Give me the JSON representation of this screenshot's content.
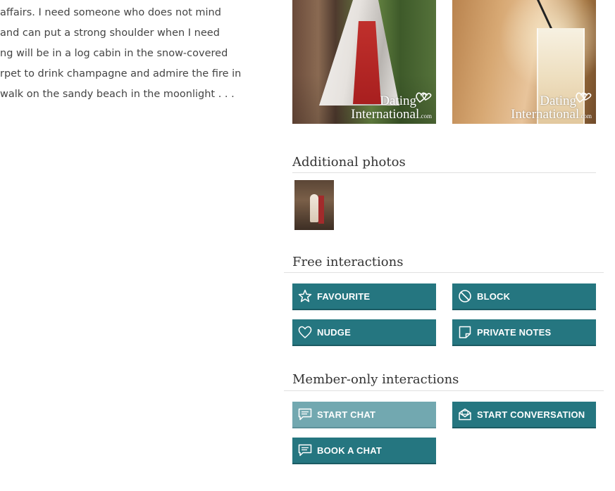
{
  "bio": {
    "lines": [
      "affairs. I need someone who does not mind",
      "and can put a strong shoulder when I need",
      "ng will be in a log cabin in the snow-covered",
      "rpet to drink champagne and admire the fire in",
      "walk on the sandy beach in the moonlight . . ."
    ]
  },
  "watermark": {
    "line1": "Dating",
    "line2": "International",
    "suffix": ".com"
  },
  "additional_photos": {
    "title": "Additional photos"
  },
  "free_interactions": {
    "title": "Free interactions",
    "buttons": [
      "FAVOURITE",
      "BLOCK",
      "NUDGE",
      "PRIVATE NOTES"
    ]
  },
  "member_interactions": {
    "title": "Member-only interactions",
    "buttons": [
      "START CHAT",
      "START CONVERSATION",
      "BOOK A CHAT"
    ]
  },
  "colors": {
    "button": "#257680",
    "button_disabled": "#72a8b0",
    "heading": "#333333"
  }
}
